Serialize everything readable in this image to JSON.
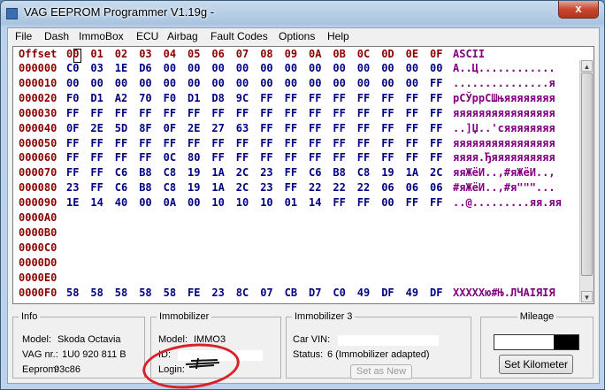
{
  "window": {
    "title": "VAG EEPROM Programmer  V1.19g -",
    "close_glyph": "x"
  },
  "menu": [
    "File",
    "Dash",
    "ImmoBox",
    "ECU",
    "Airbag",
    "Fault Codes",
    "Options",
    "Help"
  ],
  "hexview": {
    "header": {
      "offset": "Offset",
      "cols": [
        "00",
        "01",
        "02",
        "03",
        "04",
        "05",
        "06",
        "07",
        "08",
        "09",
        "0A",
        "0B",
        "0C",
        "0D",
        "0E",
        "0F"
      ],
      "ascii": "ASCII"
    },
    "rows": [
      {
        "offset": "000000",
        "bytes": [
          "C0",
          "03",
          "1E",
          "D6",
          "00",
          "00",
          "00",
          "00",
          "00",
          "00",
          "00",
          "00",
          "00",
          "00",
          "00",
          "00"
        ],
        "ascii": "А..Ц............"
      },
      {
        "offset": "000010",
        "bytes": [
          "00",
          "00",
          "00",
          "00",
          "00",
          "00",
          "00",
          "00",
          "00",
          "00",
          "00",
          "00",
          "00",
          "00",
          "00",
          "FF"
        ],
        "ascii": "...............я"
      },
      {
        "offset": "000020",
        "bytes": [
          "F0",
          "D1",
          "A2",
          "70",
          "F0",
          "D1",
          "D8",
          "9C",
          "FF",
          "FF",
          "FF",
          "FF",
          "FF",
          "FF",
          "FF",
          "FF"
        ],
        "ascii": "рСЎррСШњяяяяяяяя"
      },
      {
        "offset": "000030",
        "bytes": [
          "FF",
          "FF",
          "FF",
          "FF",
          "FF",
          "FF",
          "FF",
          "FF",
          "FF",
          "FF",
          "FF",
          "FF",
          "FF",
          "FF",
          "FF",
          "FF"
        ],
        "ascii": "яяяяяяяяяяяяяяяя"
      },
      {
        "offset": "000040",
        "bytes": [
          "0F",
          "2E",
          "5D",
          "8F",
          "0F",
          "2E",
          "27",
          "63",
          "FF",
          "FF",
          "FF",
          "FF",
          "FF",
          "FF",
          "FF",
          "FF"
        ],
        "ascii": "..]Џ..'cяяяяяяяя"
      },
      {
        "offset": "000050",
        "bytes": [
          "FF",
          "FF",
          "FF",
          "FF",
          "FF",
          "FF",
          "FF",
          "FF",
          "FF",
          "FF",
          "FF",
          "FF",
          "FF",
          "FF",
          "FF",
          "FF"
        ],
        "ascii": "яяяяяяяяяяяяяяяя"
      },
      {
        "offset": "000060",
        "bytes": [
          "FF",
          "FF",
          "FF",
          "FF",
          "0C",
          "80",
          "FF",
          "FF",
          "FF",
          "FF",
          "FF",
          "FF",
          "FF",
          "FF",
          "FF",
          "FF"
        ],
        "ascii": "яяяя.Ђяяяяяяяяяя"
      },
      {
        "offset": "000070",
        "bytes": [
          "FF",
          "FF",
          "C6",
          "B8",
          "C8",
          "19",
          "1A",
          "2C",
          "23",
          "FF",
          "C6",
          "B8",
          "C8",
          "19",
          "1A",
          "2C"
        ],
        "ascii": "яяЖёИ..,#яЖёИ..,"
      },
      {
        "offset": "000080",
        "bytes": [
          "23",
          "FF",
          "C6",
          "B8",
          "C8",
          "19",
          "1A",
          "2C",
          "23",
          "FF",
          "22",
          "22",
          "22",
          "06",
          "06",
          "06"
        ],
        "ascii": "#яЖёИ..,#я\"\"\"..."
      },
      {
        "offset": "000090",
        "bytes": [
          "1E",
          "14",
          "40",
          "00",
          "0A",
          "00",
          "10",
          "10",
          "10",
          "01",
          "14",
          "FF",
          "FF",
          "00",
          "FF",
          "FF"
        ],
        "ascii": "..@.........яя.яя"
      },
      {
        "offset": "0000A0",
        "bytes": [],
        "ascii": ""
      },
      {
        "offset": "0000B0",
        "bytes": [],
        "ascii": ""
      },
      {
        "offset": "0000C0",
        "bytes": [],
        "ascii": ""
      },
      {
        "offset": "0000D0",
        "bytes": [],
        "ascii": ""
      },
      {
        "offset": "0000E0",
        "bytes": [],
        "ascii": ""
      },
      {
        "offset": "0000F0",
        "bytes": [
          "58",
          "58",
          "58",
          "58",
          "58",
          "FE",
          "23",
          "8C",
          "07",
          "CB",
          "D7",
          "C0",
          "49",
          "DF",
          "49",
          "DF"
        ],
        "ascii": "XXXXXю#Њ.ЛЧАІЯІЯ"
      }
    ]
  },
  "info": {
    "legend": "Info",
    "model_label": "Model:",
    "model_value": "Skoda Octavia",
    "vag_label": "VAG nr.:",
    "vag_value": "1U0 920 811 B",
    "eeprom_label": "Eeprom:",
    "eeprom_value": "93c86"
  },
  "immobilizer": {
    "legend": "Immobilizer",
    "model_label": "Model:",
    "model_value": "IMMO3",
    "id_label": "ID:",
    "login_label": "Login:"
  },
  "immobilizer3": {
    "legend": "Immobilizer 3",
    "vin_label": "Car VIN:",
    "status_label": "Status:",
    "status_value": "6 (Immobilizer adapted)",
    "set_as_new": "Set as New"
  },
  "mileage": {
    "legend": "Mileage",
    "fill_fraction": 0.3,
    "set_km": "Set Kilometer"
  }
}
